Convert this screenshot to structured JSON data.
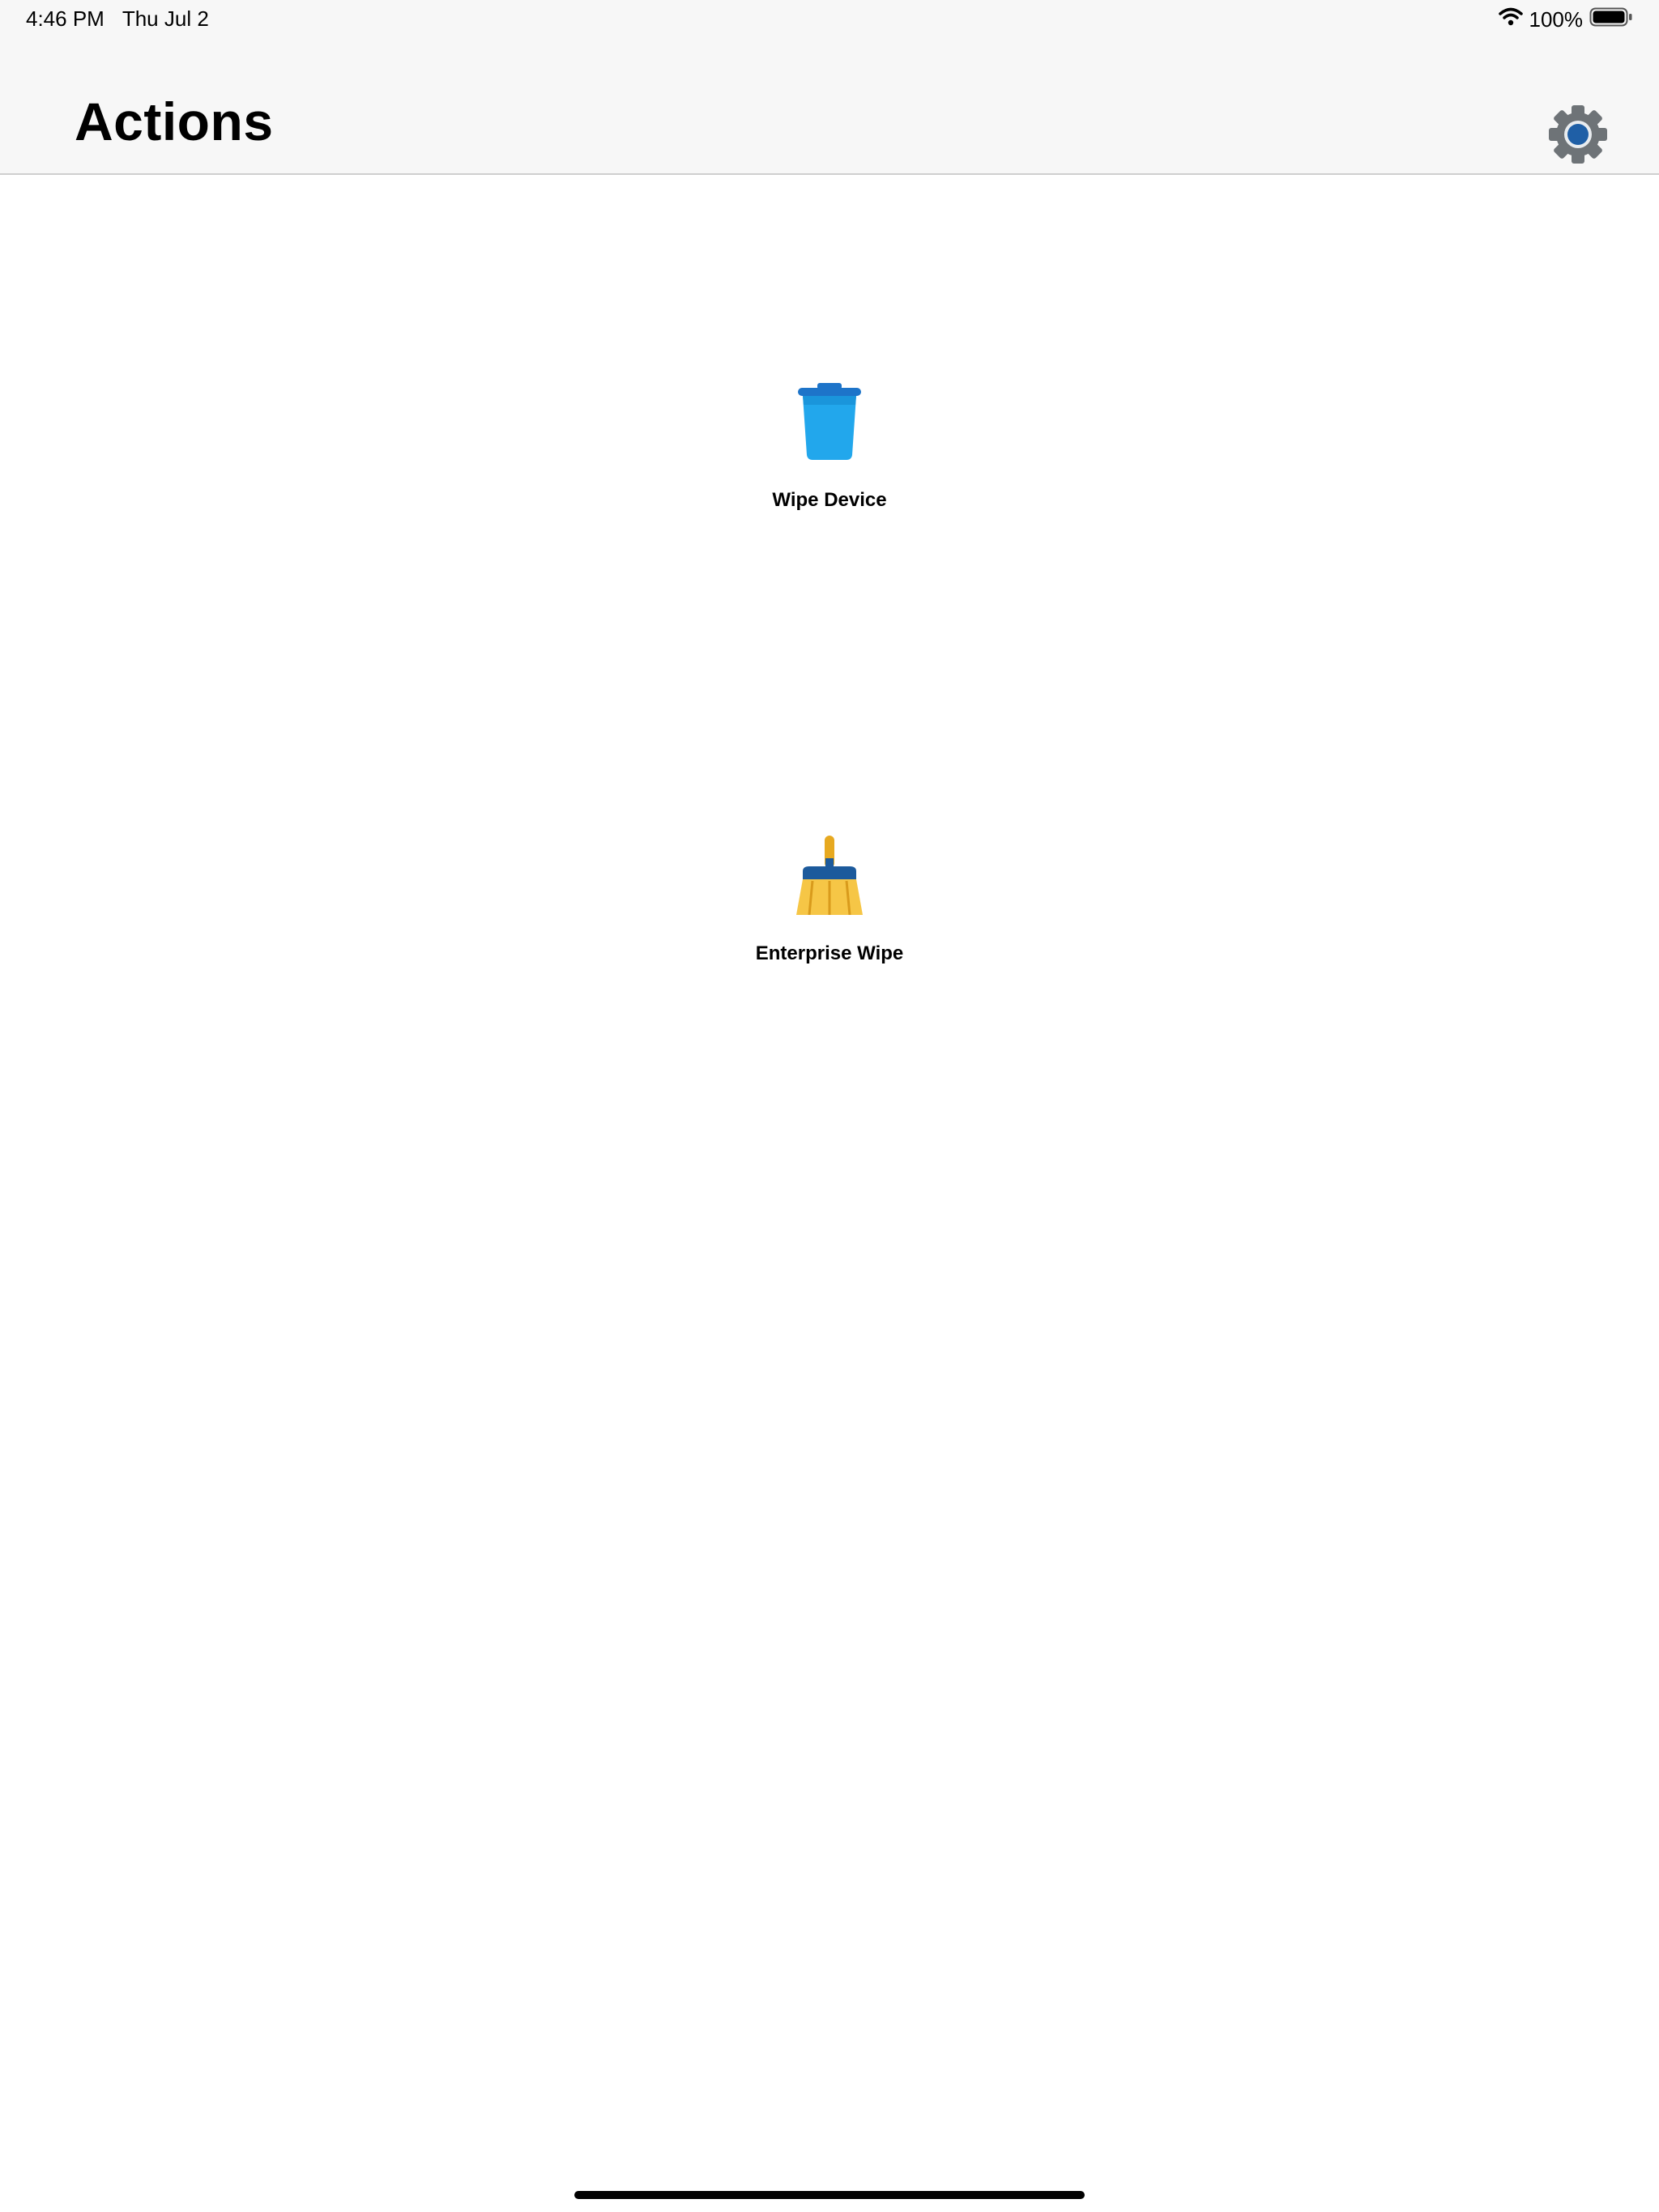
{
  "status_bar": {
    "time": "4:46 PM",
    "date": "Thu Jul 2",
    "battery": "100%",
    "wifi_icon": "wifi-icon",
    "battery_icon": "battery-icon"
  },
  "header": {
    "title": "Actions",
    "settings_icon": "gear-icon"
  },
  "actions": [
    {
      "label": "Wipe Device",
      "icon": "trash-can-icon"
    },
    {
      "label": "Enterprise Wipe",
      "icon": "broom-icon"
    }
  ],
  "colors": {
    "header_background": "#f7f7f7",
    "gear_gray": "#6e7377",
    "gear_center": "#1f5fa6",
    "trash_blue": "#22a7ec",
    "broom_yellow": "#f6c646",
    "broom_band": "#1c5a9c"
  }
}
